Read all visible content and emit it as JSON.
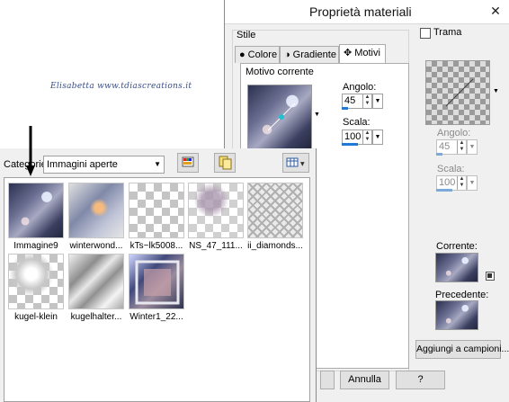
{
  "watermark": "Elisabetta www.tdiascreations.it",
  "dialog": {
    "title": "Proprietà materiali",
    "close_glyph": "✕",
    "style_group_label": "Stile",
    "tabs": [
      {
        "label": "Colore",
        "icon": "dot-icon"
      },
      {
        "label": "Gradiente",
        "icon": "gradient-icon"
      },
      {
        "label": "Motivi",
        "icon": "move-icon",
        "active": true
      }
    ],
    "pattern": {
      "current_label": "Motivo corrente",
      "angle_label": "Angolo:",
      "angle_value": "45",
      "scale_label": "Scala:",
      "scale_value": "100"
    },
    "texture": {
      "checkbox_label": "Trama",
      "checked": false,
      "angle_label": "Angolo:",
      "angle_value": "45",
      "scale_label": "Scala:",
      "scale_value": "100"
    },
    "current_label": "Corrente:",
    "previous_label": "Precedente:",
    "add_to_swatches": "Aggiungi a campioni...",
    "cancel": "Annulla",
    "help": "?"
  },
  "picker": {
    "category_label": "Categorie:",
    "category_value": "Immagini aperte",
    "items": [
      {
        "label": "Immagine9",
        "style": "pattern"
      },
      {
        "label": "winterwond...",
        "style": "winterw"
      },
      {
        "label": "kTs~lk5008...",
        "style": "check"
      },
      {
        "label": "NS_47_111...",
        "style": "ns47"
      },
      {
        "label": "ii_diamonds...",
        "style": "diamond"
      },
      {
        "label": "kugel-klein",
        "style": "kugel"
      },
      {
        "label": "kugelhalter...",
        "style": "halter"
      },
      {
        "label": "Winter1_22...",
        "style": "winter1"
      }
    ]
  }
}
